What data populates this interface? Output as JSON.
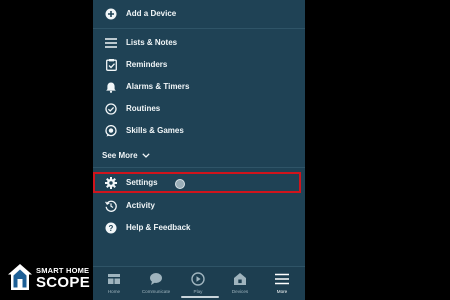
{
  "menu": {
    "add_device": "Add a Device",
    "lists_notes": "Lists & Notes",
    "reminders": "Reminders",
    "alarms_timers": "Alarms & Timers",
    "routines": "Routines",
    "skills_games": "Skills & Games",
    "see_more": "See More",
    "settings": "Settings",
    "activity": "Activity",
    "help_feedback": "Help & Feedback"
  },
  "bottom_nav": {
    "home": "Home",
    "communicate": "Communicate",
    "play": "Play",
    "devices": "Devices",
    "more": "More",
    "active": "more"
  },
  "watermark": {
    "line1": "SMART HOME",
    "line2": "SCOPE"
  },
  "colors": {
    "panel_bg": "#1f4255",
    "highlight": "#d0141c",
    "text": "#f1f6f8"
  }
}
